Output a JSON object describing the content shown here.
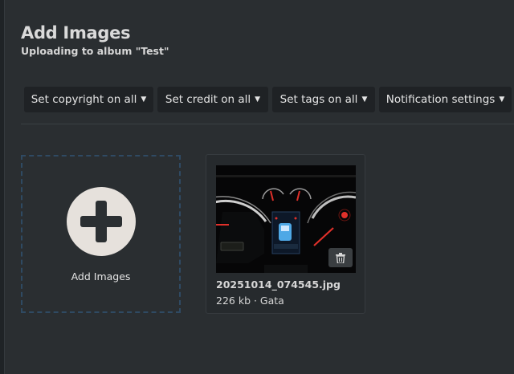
{
  "header": {
    "title": "Add Images",
    "subtitle": "Uploading to album \"Test\""
  },
  "toolbar": {
    "buttons": [
      {
        "label": "Set copyright on all",
        "icon": "caret-down-icon"
      },
      {
        "label": "Set credit on all",
        "icon": "caret-down-icon"
      },
      {
        "label": "Set tags on all",
        "icon": "caret-down-icon"
      },
      {
        "label": "Notification settings",
        "icon": "caret-down-icon"
      }
    ]
  },
  "dropzone": {
    "label": "Add Images",
    "icon": "plus-icon"
  },
  "uploads": [
    {
      "filename": "20251014_074545.jpg",
      "meta": "226 kb · Gata",
      "thumbnail": "car-dashboard-instrument-cluster-photo",
      "delete_icon": "trash-icon"
    }
  ],
  "colors": {
    "background": "#2a2e31",
    "button_bg": "#1f2225",
    "dropzone_border": "#2f4a63",
    "plus_circle": "#e6e1dc"
  }
}
